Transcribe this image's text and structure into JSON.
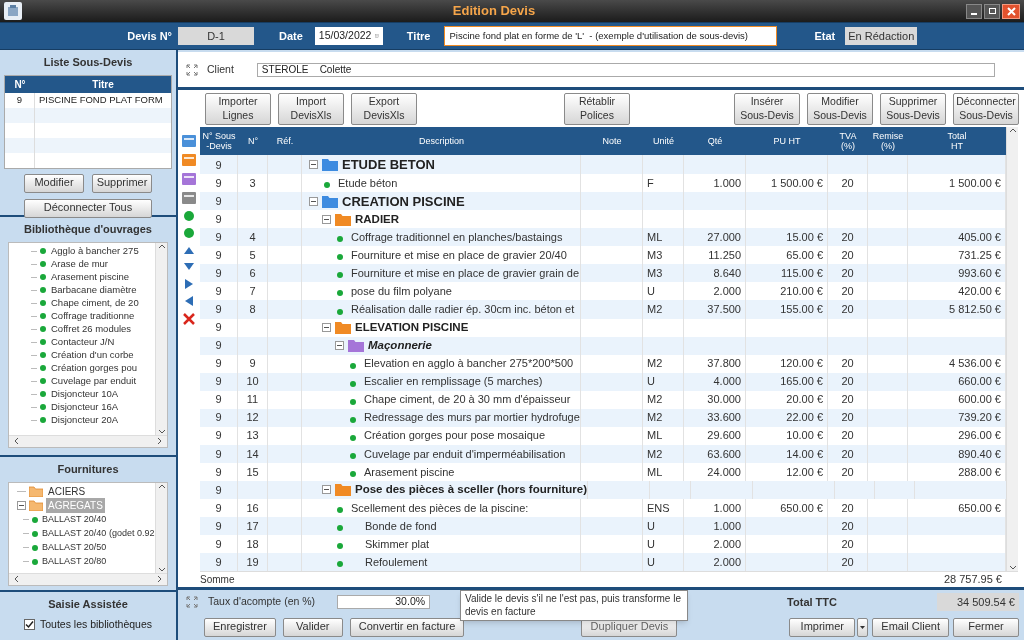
{
  "window": {
    "title": "Edition Devis"
  },
  "header": {
    "devis_label": "Devis N°",
    "devis_value": "D-1",
    "date_label": "Date",
    "date_value": "15/03/2022",
    "titre_label": "Titre",
    "titre_value": "Piscine fond plat en forme de 'L'  - (exemple d'utilisation de sous-devis)",
    "etat_label": "Etat",
    "etat_value": "En Rédaction"
  },
  "sous_devis": {
    "title": "Liste Sous-Devis",
    "columns": [
      "N°",
      "Titre"
    ],
    "rows": [
      {
        "n": "9",
        "titre": "PISCINE FOND PLAT FORM"
      }
    ],
    "buttons": [
      "Modifier",
      "Supprimer",
      "Déconnecter Tous"
    ]
  },
  "bibliotheque": {
    "title": "Bibliothèque d'ouvrages",
    "items": [
      "Agglo à bancher 275",
      "Arase de mur",
      "Arasement piscine",
      "Barbacane diamètre",
      "Chape ciment, de 20",
      "Coffrage traditionne",
      "Coffret 26 modules",
      "Contacteur J/N",
      "Création d'un corbe",
      "Création gorges pou",
      "Cuvelage par enduit",
      "Disjoncteur 10A",
      "Disjoncteur 16A",
      "Disjoncteur 20A"
    ]
  },
  "fournitures": {
    "title": "Fournitures",
    "items": [
      {
        "label": "ACIERS",
        "selected": false,
        "expanded": false
      },
      {
        "label": "AGREGATS",
        "selected": true,
        "expanded": true,
        "children": [
          "BALLAST 20/40",
          "BALLAST 20/40 (godet 0.92",
          "BALLAST 20/50",
          "BALLAST 20/80"
        ]
      }
    ]
  },
  "saisie": {
    "title": "Saisie Assistée",
    "option": "Toutes les bibliothèques",
    "checked": true
  },
  "client": {
    "label": "Client",
    "value": "STEROLE    Colette"
  },
  "toolbar": {
    "left": [
      "Importer\nLignes",
      "Import\nDevisXls",
      "Export\nDevisXls"
    ],
    "center": [
      "Rétablir\nPolices"
    ],
    "right": [
      "Insérer\nSous-Devis",
      "Modifier\nSous-Devis",
      "Supprimer\nSous-Devis",
      "Déconnecter\nSous-Devis"
    ]
  },
  "table": {
    "columns": [
      "N° Sous\n-Devis",
      "N°",
      "Réf.",
      "Description",
      "Note",
      "Unité",
      "Qté",
      "PU HT",
      "TVA\n(%)",
      "Remise\n(%)",
      "Total\nHT"
    ],
    "rows": [
      {
        "kind": "chapter",
        "sous_devis": "9",
        "description": "ETUDE BETON",
        "expanded": true,
        "children": [
          {
            "kind": "item",
            "sous_devis": "9",
            "n": "3",
            "description": "Etude béton",
            "unite": "F",
            "qte": "1.000",
            "pu_ht": "1 500.00 €",
            "tva": "20",
            "total_ht": "1 500.00 €"
          }
        ]
      },
      {
        "kind": "chapter",
        "sous_devis": "9",
        "description": "CREATION PISCINE",
        "expanded": true,
        "children": [
          {
            "kind": "section",
            "sous_devis": "9",
            "description": "RADIER",
            "expanded": true,
            "children": [
              {
                "kind": "item",
                "sous_devis": "9",
                "n": "4",
                "description": "Coffrage traditionnel en planches/bastaings",
                "unite": "ML",
                "qte": "27.000",
                "pu_ht": "15.00 €",
                "tva": "20",
                "total_ht": "405.00 €"
              },
              {
                "kind": "item",
                "sous_devis": "9",
                "n": "5",
                "description": "Fourniture et mise en place de gravier 20/40",
                "unite": "M3",
                "qte": "11.250",
                "pu_ht": "65.00 €",
                "tva": "20",
                "total_ht": "731.25 €"
              },
              {
                "kind": "item",
                "sous_devis": "9",
                "n": "6",
                "description": "Fourniture et mise en place de gravier grain de",
                "unite": "M3",
                "qte": "8.640",
                "pu_ht": "115.00 €",
                "tva": "20",
                "total_ht": "993.60 €"
              },
              {
                "kind": "item",
                "sous_devis": "9",
                "n": "7",
                "description": "pose du film polyane",
                "unite": "U",
                "qte": "2.000",
                "pu_ht": "210.00 €",
                "tva": "20",
                "total_ht": "420.00 €"
              },
              {
                "kind": "item",
                "sous_devis": "9",
                "n": "8",
                "description": "Réalisation dalle radier ép. 30cm inc. béton et",
                "unite": "M2",
                "qte": "37.500",
                "pu_ht": "155.00 €",
                "tva": "20",
                "total_ht": "5 812.50 €"
              }
            ]
          },
          {
            "kind": "section",
            "sous_devis": "9",
            "description": "ELEVATION PISCINE",
            "expanded": true,
            "children": [
              {
                "kind": "subsection",
                "sous_devis": "9",
                "description": "Maçonnerie",
                "expanded": true,
                "children": [
                  {
                    "kind": "item",
                    "sous_devis": "9",
                    "n": "9",
                    "description": "Elevation en agglo à bancher 275*200*500",
                    "unite": "M2",
                    "qte": "37.800",
                    "pu_ht": "120.00 €",
                    "tva": "20",
                    "total_ht": "4 536.00 €"
                  },
                  {
                    "kind": "item",
                    "sous_devis": "9",
                    "n": "10",
                    "description": "Escalier en remplissage (5 marches)",
                    "unite": "U",
                    "qte": "4.000",
                    "pu_ht": "165.00 €",
                    "tva": "20",
                    "total_ht": "660.00 €"
                  },
                  {
                    "kind": "item",
                    "sous_devis": "9",
                    "n": "11",
                    "description": "Chape ciment, de 20 à 30 mm d'épaisseur",
                    "unite": "M2",
                    "qte": "30.000",
                    "pu_ht": "20.00 €",
                    "tva": "20",
                    "total_ht": "600.00 €"
                  },
                  {
                    "kind": "item",
                    "sous_devis": "9",
                    "n": "12",
                    "description": "Redressage des murs par mortier hydrofuge",
                    "unite": "M2",
                    "qte": "33.600",
                    "pu_ht": "22.00 €",
                    "tva": "20",
                    "total_ht": "739.20 €"
                  },
                  {
                    "kind": "item",
                    "sous_devis": "9",
                    "n": "13",
                    "description": "Création gorges pour pose mosaique",
                    "unite": "ML",
                    "qte": "29.600",
                    "pu_ht": "10.00 €",
                    "tva": "20",
                    "total_ht": "296.00 €"
                  },
                  {
                    "kind": "item",
                    "sous_devis": "9",
                    "n": "14",
                    "description": "Cuvelage par enduit d'imperméabilisation",
                    "unite": "M2",
                    "qte": "63.600",
                    "pu_ht": "14.00 €",
                    "tva": "20",
                    "total_ht": "890.40 €"
                  },
                  {
                    "kind": "item",
                    "sous_devis": "9",
                    "n": "15",
                    "description": "Arasement piscine",
                    "unite": "ML",
                    "qte": "24.000",
                    "pu_ht": "12.00 €",
                    "tva": "20",
                    "total_ht": "288.00 €"
                  }
                ]
              }
            ]
          },
          {
            "kind": "section",
            "sous_devis": "9",
            "description": "Pose des pièces à sceller (hors fourniture)",
            "expanded": true,
            "children": [
              {
                "kind": "item",
                "sous_devis": "9",
                "n": "16",
                "description": "Scellement des pièces de la piscine:",
                "unite": "ENS",
                "qte": "1.000",
                "pu_ht": "650.00 €",
                "tva": "20",
                "total_ht": "650.00 €"
              },
              {
                "kind": "subitem",
                "sous_devis": "9",
                "n": "17",
                "description": "Bonde de fond",
                "unite": "U",
                "qte": "1.000",
                "tva": "20"
              },
              {
                "kind": "subitem",
                "sous_devis": "9",
                "n": "18",
                "description": "Skimmer plat",
                "unite": "U",
                "qte": "2.000",
                "tva": "20"
              },
              {
                "kind": "subitem",
                "sous_devis": "9",
                "n": "19",
                "description": "Refoulement",
                "unite": "U",
                "qte": "2.000",
                "tva": "20"
              }
            ]
          }
        ]
      }
    ],
    "sum_label": "Somme",
    "sum_value": "28 757.95 €"
  },
  "footer": {
    "acompte_label": "Taux d'acompte (en %)",
    "acompte_value": "30.0%",
    "total_label": "Total TTC",
    "total_value": "34 509.54 €",
    "buttons": {
      "left": [
        "Enregistrer",
        "Valider",
        "Convertir en facture"
      ],
      "center": [
        "Dupliquer Devis"
      ],
      "right": [
        {
          "label": "Imprimer",
          "kind": "split"
        },
        {
          "label": "Email Client",
          "kind": "plain"
        },
        {
          "label": "Fermer",
          "kind": "plain"
        }
      ]
    },
    "tooltip": "Valide le devis s'il ne l'est pas, puis transforme le devis en facture"
  }
}
